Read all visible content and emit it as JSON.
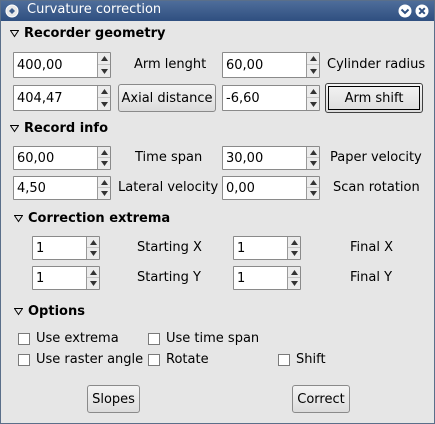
{
  "window": {
    "title": "Curvature correction",
    "app_icon": "app-menu-icon",
    "buttons": [
      "shade-icon",
      "close-icon"
    ]
  },
  "recorder_geometry": {
    "heading": "Recorder geometry",
    "arm_length": {
      "value": "400,00",
      "label": "Arm lenght"
    },
    "cylinder_radius": {
      "value": "60,00",
      "label": "Cylinder radius"
    },
    "axial_distance": {
      "value": "404,47",
      "button_label": "Axial distance"
    },
    "arm_shift": {
      "value": "-6,60",
      "button_label": "Arm shift"
    }
  },
  "record_info": {
    "heading": "Record info",
    "time_span": {
      "value": "60,00",
      "label": "Time span"
    },
    "paper_velocity": {
      "value": "30,00",
      "label": "Paper velocity"
    },
    "lateral_velocity": {
      "value": "4,50",
      "label": "Lateral velocity"
    },
    "scan_rotation": {
      "value": "0,00",
      "label": "Scan rotation"
    }
  },
  "correction_extrema": {
    "heading": "Correction extrema",
    "starting_x": {
      "value": "1",
      "label": "Starting X"
    },
    "final_x": {
      "value": "1",
      "label": "Final X"
    },
    "starting_y": {
      "value": "1",
      "label": "Starting Y"
    },
    "final_y": {
      "value": "1",
      "label": "Final Y"
    }
  },
  "options": {
    "heading": "Options",
    "use_extrema": {
      "label": "Use extrema",
      "checked": false
    },
    "use_time_span": {
      "label": "Use time span",
      "checked": false
    },
    "use_raster_angle": {
      "label": "Use raster angle",
      "checked": false
    },
    "rotate": {
      "label": "Rotate",
      "checked": false
    },
    "shift": {
      "label": "Shift",
      "checked": false
    }
  },
  "actions": {
    "slopes_label": "Slopes",
    "correct_label": "Correct"
  },
  "colors": {
    "titlebar": "#3d5d8c",
    "background": "#e6e6e6"
  }
}
